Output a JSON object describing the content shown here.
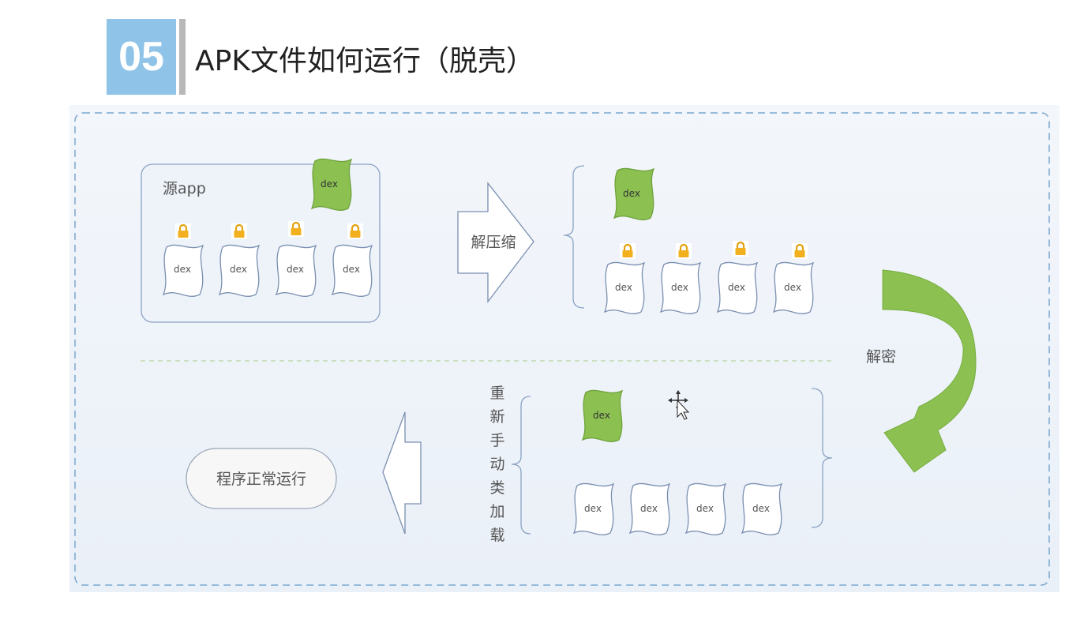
{
  "header": {
    "number": "05",
    "title": "APK文件如何运行（脱壳）"
  },
  "diagram": {
    "source_app_label": "源app",
    "dex_label": "dex",
    "unzip_label": "解压缩",
    "decrypt_label": "解密",
    "reload_label_chars": [
      "重",
      "新",
      "手",
      "动",
      "类",
      "加",
      "载"
    ],
    "run_label": "程序正常运行"
  },
  "colors": {
    "accent_box": "#8fc3e8",
    "green": "#8cc152",
    "lock": "#f2b01e",
    "dashed_border": "#7ba7d0"
  }
}
